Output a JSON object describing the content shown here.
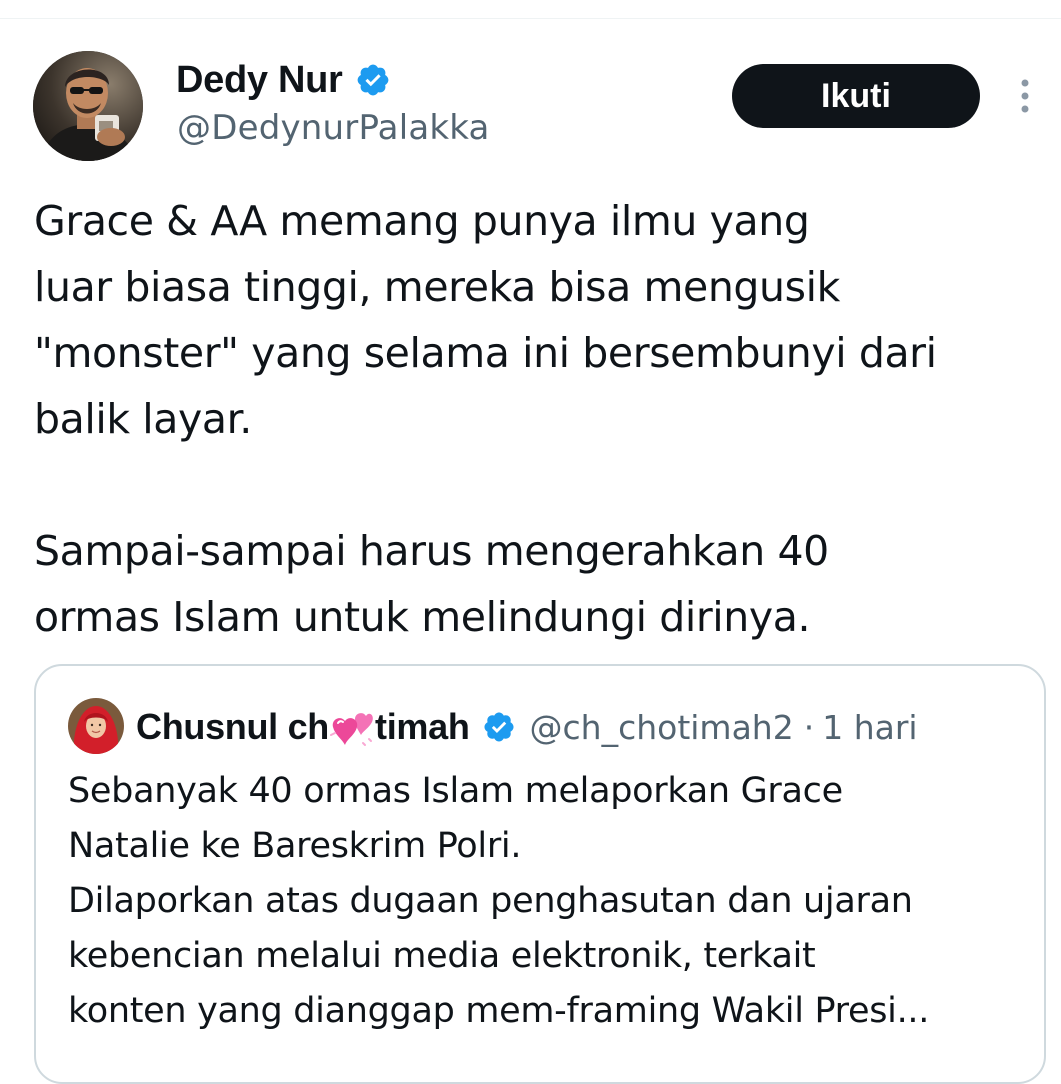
{
  "author": {
    "display_name": "Dedy Nur",
    "handle": "@DedynurPalakka",
    "avatar_icon": "profile-photo",
    "verified_icon": "verified-badge-icon"
  },
  "actions": {
    "follow_label": "Ikuti",
    "more_icon": "more-vertical-icon"
  },
  "tweet": {
    "lines": [
      "Grace & AA memang punya ilmu yang",
      "luar biasa tinggi, mereka bisa mengusik",
      "\"monster\" yang selama ini bersembunyi dari",
      "balik layar.",
      "",
      "Sampai-sampai harus mengerahkan 40",
      "ormas Islam untuk melindungi dirinya."
    ]
  },
  "quoted_tweet": {
    "name_part1": "Chusnul ch",
    "name_emoji": "two-hearts-emoji",
    "name_part2": "timah",
    "handle": "@ch_chotimah2",
    "separator": "·",
    "time": "1 hari",
    "lines": [
      "Sebanyak 40 ormas Islam melaporkan Grace",
      "Natalie ke Bareskrim Polri.",
      "Dilaporkan atas dugaan penghasutan dan ujaran",
      "kebencian melalui media elektronik, terkait",
      "konten yang dianggap mem-framing Wakil Presi..."
    ]
  },
  "colors": {
    "text_primary": "#0f1419",
    "text_secondary": "#536471",
    "verified_blue": "#1d9bf0",
    "border": "#cfd9de",
    "heart_pink": "#f472b6"
  }
}
